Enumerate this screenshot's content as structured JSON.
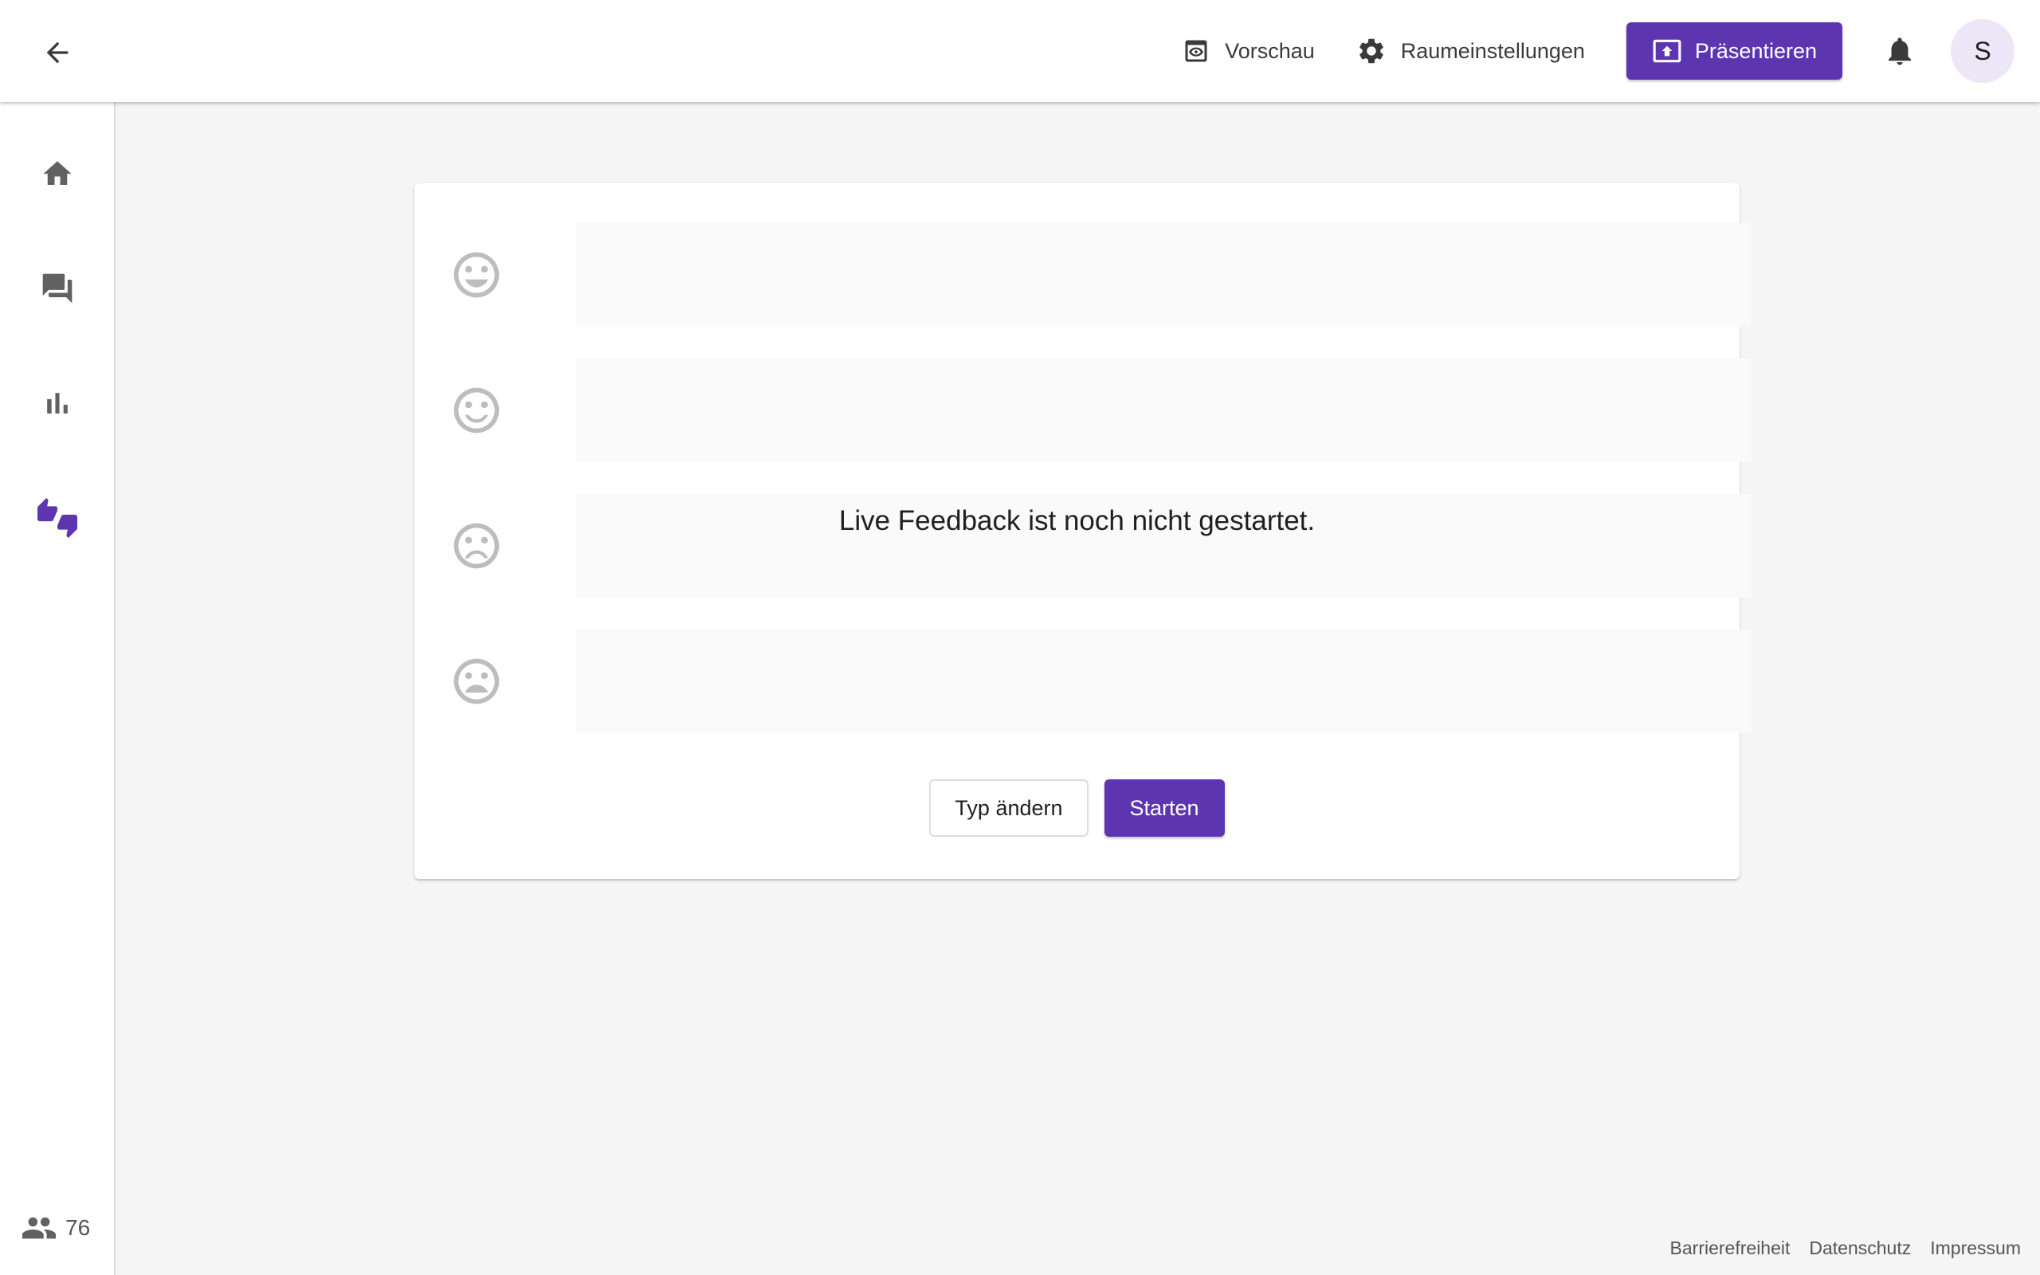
{
  "header": {
    "back_icon": "arrow-back-icon",
    "preview_label": "Vorschau",
    "settings_label": "Raumeinstellungen",
    "present_label": "Präsentieren",
    "avatar_initial": "S"
  },
  "sidebar": {
    "items": [
      {
        "icon": "home-icon",
        "active": false
      },
      {
        "icon": "forum-icon",
        "active": false
      },
      {
        "icon": "bar-chart-icon",
        "active": false
      },
      {
        "icon": "thumbs-up-down-icon",
        "active": true
      }
    ],
    "participants_count": "76"
  },
  "feedback": {
    "rows": [
      {
        "icon": "very-happy-face-icon"
      },
      {
        "icon": "happy-face-icon"
      },
      {
        "icon": "sad-face-icon"
      },
      {
        "icon": "very-sad-face-icon"
      }
    ],
    "status_message": "Live Feedback ist noch nicht gestartet.",
    "change_type_label": "Typ ändern",
    "start_label": "Starten"
  },
  "footer": {
    "accessibility": "Barrierefreiheit",
    "privacy": "Datenschutz",
    "imprint": "Impressum"
  },
  "colors": {
    "accent": "#5e35b1",
    "icon_grey": "#616161",
    "emoji_grey": "#bdbdbd"
  }
}
